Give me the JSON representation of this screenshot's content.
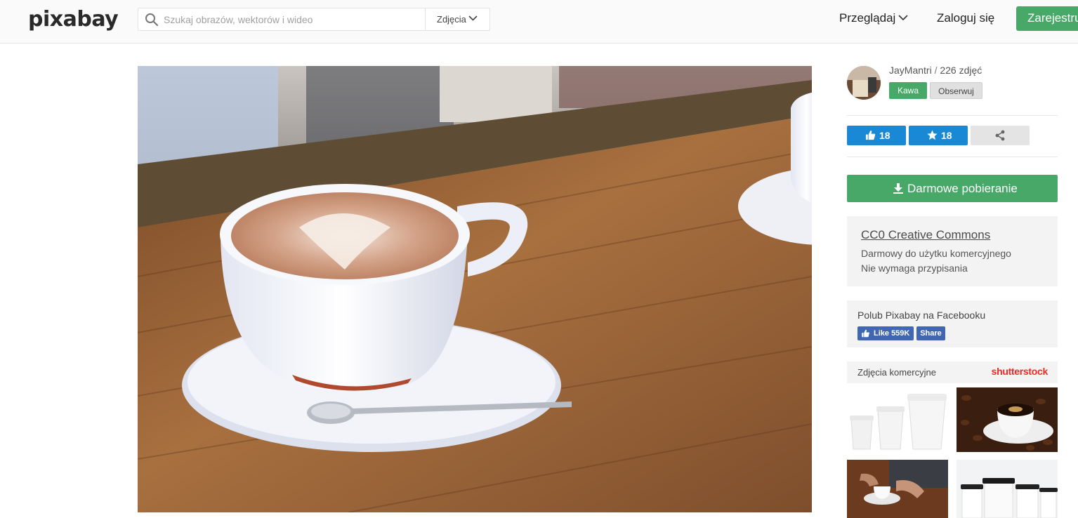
{
  "header": {
    "logo_text": "pixabay",
    "search": {
      "placeholder": "Szukaj obrazów, wektorów i wideo",
      "type_label": "Zdjęcia"
    },
    "nav": {
      "browse_label": "Przeglądaj",
      "login_label": "Zaloguj się",
      "register_label": "Zarejestruj się"
    }
  },
  "photo": {
    "subject_icon": "coffee-latte-photo"
  },
  "author": {
    "name": "JayMantri",
    "separator": " / ",
    "photo_count": "226 zdjęć",
    "donate_label": "Kawa",
    "follow_label": "Obserwuj"
  },
  "stats": {
    "likes": "18",
    "favorites": "18"
  },
  "download": {
    "label": "Darmowe pobieranie"
  },
  "license": {
    "title": "CC0 Creative Commons",
    "line1": "Darmowy do użytku komercyjnego",
    "line2": "Nie wymaga przypisania"
  },
  "facebook": {
    "text": "Polub Pixabay na Facebooku",
    "like_label": "Like 559K",
    "share_label": "Share"
  },
  "commercial": {
    "title": "Zdjęcia komercyjne",
    "provider": "shutterstock",
    "thumbs": [
      "paper-cups-thumb",
      "coffee-beans-cup-thumb",
      "hands-coffee-thumb",
      "black-lid-cups-thumb"
    ]
  },
  "colors": {
    "green": "#48a868",
    "blue": "#1a89d5",
    "facebook": "#4267b2",
    "shutterstock": "#ee2b24"
  }
}
